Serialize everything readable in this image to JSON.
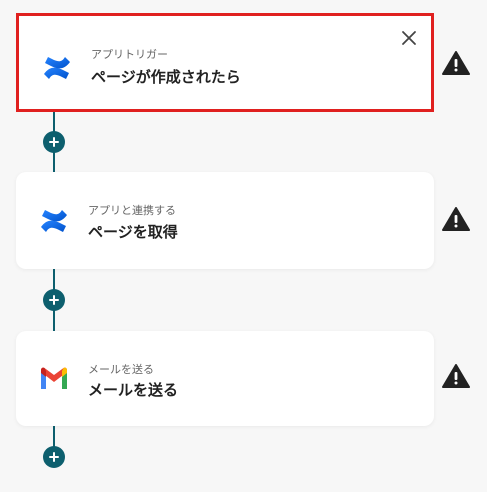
{
  "colors": {
    "accent": "#0d5f6e",
    "selected_border": "#e0201f",
    "warning": "#222222"
  },
  "steps": [
    {
      "type_label": "アプリトリガー",
      "title": "ページが作成されたら",
      "icon": "confluence-icon",
      "selected": true
    },
    {
      "type_label": "アプリと連携する",
      "title": "ページを取得",
      "icon": "confluence-icon",
      "selected": false
    },
    {
      "type_label": "メールを送る",
      "title": "メールを送る",
      "icon": "gmail-icon",
      "selected": false
    }
  ],
  "icons": {
    "add_step": "plus-icon",
    "warning": "warning-icon",
    "close": "close-icon"
  }
}
